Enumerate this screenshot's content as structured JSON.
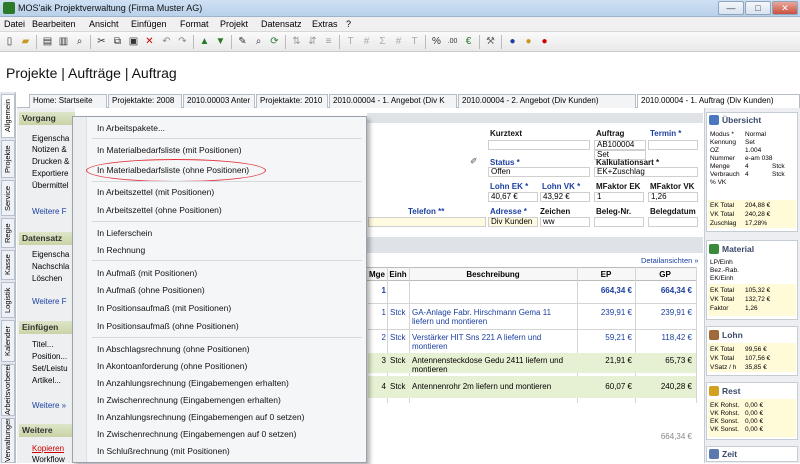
{
  "window": {
    "title": "MOS'aik Projektverwaltung (Firma Muster AG)",
    "controls": [
      "—",
      "□",
      "✕"
    ]
  },
  "menu": [
    "Datei",
    "Bearbeiten",
    "Ansicht",
    "Einfügen",
    "Format",
    "Projekt",
    "Datensatz",
    "Extras",
    "?"
  ],
  "page_title": "Projekte | Aufträge | Auftrag",
  "side_tabs": [
    "Allgemein",
    "Projekte",
    "Service",
    "Regie",
    "Kasse",
    "Logistik",
    "Kalender",
    "Arbeitsvorbereitung",
    "Verwaltungen"
  ],
  "doc_tabs": [
    "Home: Startseite",
    "Projektakte: 2008",
    "2010.00003 Anter",
    "Projektakte: 2010",
    "2010.00004 - 1. Angebot (Div K",
    "2010.00004 - 2. Angebot (Div Kunden)",
    "2010.00004 - 1. Auftrag (Div Kunden)"
  ],
  "left_panel": {
    "sections": [
      "Vorgang",
      "Datensatz",
      "Einfügen",
      "Weitere"
    ],
    "vorgang_items": [
      "Eigenscha",
      "Notizen &",
      "Drucken &",
      "Exportiere",
      "Übermittel",
      "Weitere F"
    ],
    "datensatz_items": [
      "Eigenscha",
      "Nachschla",
      "Löschen",
      "Weitere F"
    ],
    "einfuegen_items": [
      "Titel...",
      "Position...",
      "Set/Leistu",
      "Artikel...",
      "Weitere »"
    ],
    "weitere_items": [
      "Kopieren",
      "Workflow"
    ]
  },
  "form": {
    "kurztext_label": "Kurztext",
    "auftrag_label": "Auftrag",
    "auftrag_value": "AB100004",
    "termin_label": "Termin *",
    "set_value": "Set",
    "status_label": "Status *",
    "status_value": "Offen",
    "kalkulationsart_label": "Kalkulationsart *",
    "kalkulationsart_value": "EK+Zuschlag",
    "lohn_ek_label": "Lohn EK *",
    "lohn_ek_value": "40,67 €",
    "lohn_vk_label": "Lohn VK *",
    "lohn_vk_value": "43,92 €",
    "mfaktor_ek_label": "MFaktor EK",
    "mfaktor_ek_value": "1",
    "mfaktor_vk_label": "MFaktor VK",
    "mfaktor_vk_value": "1,26",
    "telefon_label": "Telefon **",
    "adresse_label": "Adresse *",
    "adresse_value": "Div Kunden",
    "zeichen_label": "Zeichen",
    "zeichen_value": "ww",
    "belegnr_label": "Beleg-Nr.",
    "belegdatum_label": "Belegdatum",
    "detail_link": "Detailansichten »"
  },
  "table": {
    "headers": [
      "Mge",
      "Einh",
      "Beschreibung",
      "EP",
      "GP"
    ],
    "rows": [
      {
        "mge": "1",
        "einh": "",
        "desc": [
          "",
          ""
        ],
        "ep": "664,34 €",
        "gp": "664,34 €"
      },
      {
        "mge": "1",
        "einh": "Stck",
        "desc": [
          "GA-Anlage Fabr. Hirschmann Gema 11",
          "liefern und montieren"
        ],
        "ep": "239,91 €",
        "gp": "239,91 €"
      },
      {
        "mge": "2",
        "einh": "Stck",
        "desc": [
          "Verstärker HIT Sns 221 A liefern und",
          "montieren"
        ],
        "ep": "59,21 €",
        "gp": "118,42 €"
      },
      {
        "mge": "3",
        "einh": "Stck",
        "desc": [
          "Antennensteckdose Gedu 2411 liefern und",
          "montieren"
        ],
        "ep": "21,91 €",
        "gp": "65,73 €"
      },
      {
        "mge": "4",
        "einh": "Stck",
        "desc": [
          "Antennenrohr 2m liefern und montieren",
          ""
        ],
        "ep": "60,07 €",
        "gp": "240,28 €"
      }
    ],
    "total": "664,34 €"
  },
  "context_menu": [
    "In Arbeitspakete...",
    "In Materialbedarfsliste (mit Positionen)",
    "In Materialbedarfsliste (ohne Positionen)",
    "In Arbeitszettel (mit Positionen)",
    "In Arbeitszettel (ohne Positionen)",
    "In Lieferschein",
    "In Rechnung",
    "In Aufmaß (mit Positionen)",
    "In Aufmaß (ohne Positionen)",
    "In Positionsaufmaß (mit Positionen)",
    "In Positionsaufmaß (ohne Positionen)",
    "In Abschlagsrechnung (ohne Positionen)",
    "In Akontoanforderung (ohne Positionen)",
    "In Anzahlungsrechnung (Eingabemengen erhalten)",
    "In Zwischenrechnung (Eingabemengen erhalten)",
    "In Anzahlungsrechnung (Eingabemengen auf 0 setzen)",
    "In Zwischenrechnung (Eingabemengen auf 0 setzen)",
    "In Schlußrechnung (mit Positionen)"
  ],
  "right_panel": {
    "uebersicht": {
      "title": "Übersicht",
      "rows": [
        [
          "Modus *",
          "Normal"
        ],
        [
          "Kennung",
          "Set"
        ],
        [
          "OZ",
          "1.004"
        ],
        [
          "Nummer",
          "e-am 038"
        ],
        [
          "Menge",
          "4",
          "Stck"
        ],
        [
          "Verbrauch",
          "4",
          "Stck"
        ],
        [
          "% VK",
          ""
        ]
      ],
      "totals": [
        [
          "EK Total",
          "204,88 €"
        ],
        [
          "VK Total",
          "240,28 €"
        ],
        [
          "Zuschlag",
          "17,28%"
        ]
      ]
    },
    "material": {
      "title": "Material",
      "rows": [
        [
          "LP/Einh",
          ""
        ],
        [
          "Bez.-Rab.",
          ""
        ],
        [
          "EK/Einh",
          ""
        ],
        [
          "EK Total",
          "105,32 €"
        ],
        [
          "VK Total",
          "132,72 €"
        ],
        [
          "Faktor",
          "1,26"
        ]
      ]
    },
    "lohn": {
      "title": "Lohn",
      "rows": [
        [
          "EK Total",
          "99,56 €"
        ],
        [
          "VK Total",
          "107,56 €"
        ],
        [
          "VSatz / h",
          "35,85 €"
        ]
      ]
    },
    "rest": {
      "title": "Rest",
      "rows": [
        [
          "EK Rohst.",
          "0,00 €"
        ],
        [
          "VK Rohst.",
          "0,00 €"
        ],
        [
          "EK Sonst.",
          "0,00 €"
        ],
        [
          "VK Sonst.",
          "0,00 €"
        ]
      ]
    },
    "zeit": {
      "title": "Zeit"
    }
  },
  "colors": {
    "accent": "#1a3fa0",
    "highlight_oval": "#e0333a",
    "section_green": "#c8d4a6"
  }
}
